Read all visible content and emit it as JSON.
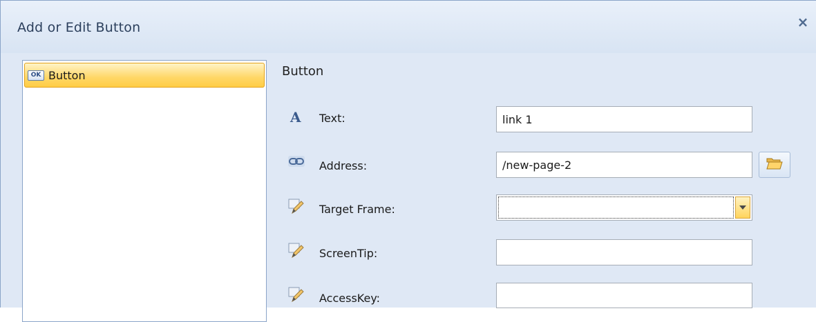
{
  "dialog": {
    "title": "Add or Edit Button",
    "close_label": "×"
  },
  "tree": {
    "items": [
      {
        "icon": "ok-button-icon",
        "icon_text": "OK",
        "label": "Button",
        "selected": true
      }
    ]
  },
  "form": {
    "section_title": "Button",
    "fields": {
      "text": {
        "icon": "text-a-icon",
        "label": "Text:",
        "value": "link 1"
      },
      "address": {
        "icon": "link-chain-icon",
        "label": "Address:",
        "value": "/new-page-2"
      },
      "target_frame": {
        "icon": "pencil-edit-icon",
        "label": "Target Frame:",
        "value": ""
      },
      "screentip": {
        "icon": "pencil-edit-icon",
        "label": "ScreenTip:",
        "value": ""
      },
      "accesskey": {
        "icon": "pencil-edit-icon",
        "label": "AccessKey:",
        "value": ""
      }
    }
  },
  "colors": {
    "dialog_bg": "#dfe8f5",
    "selection": "#ffd767",
    "border": "#8aa4c8"
  }
}
